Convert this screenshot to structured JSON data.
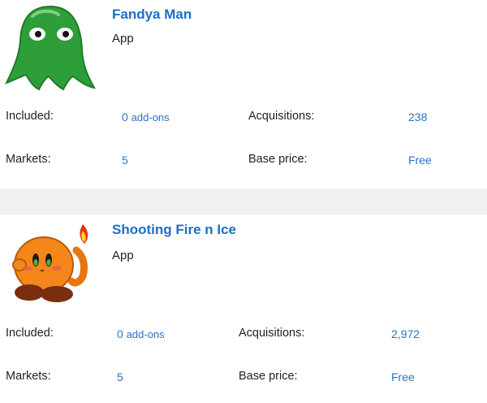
{
  "apps": [
    {
      "title": "Fandya Man",
      "type": "App",
      "icon": "green-blob-character-icon",
      "included_label": "Included:",
      "included_count": "0",
      "included_unit": "add-ons",
      "acquisitions_label": "Acquisitions:",
      "acquisitions_value": "238",
      "markets_label": "Markets:",
      "markets_value": "5",
      "base_price_label": "Base price:",
      "base_price_value": "Free"
    },
    {
      "title": "Shooting Fire n Ice",
      "type": "App",
      "icon": "orange-fire-creature-icon",
      "included_label": "Included:",
      "included_count": "0",
      "included_unit": "add-ons",
      "acquisitions_label": "Acquisitions:",
      "acquisitions_value": "2,972",
      "markets_label": "Markets:",
      "markets_value": "5",
      "base_price_label": "Base price:",
      "base_price_value": "Free"
    }
  ],
  "colors": {
    "link": "#1b6fc7",
    "separator": "#f0f0f0"
  }
}
